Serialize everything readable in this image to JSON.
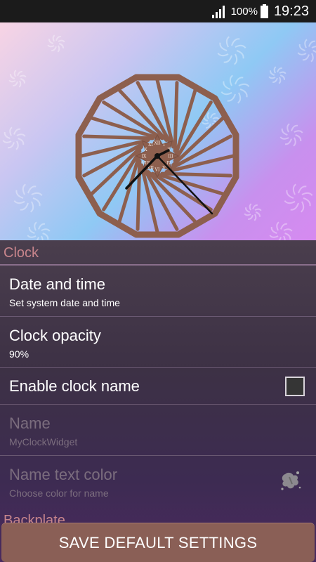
{
  "status_bar": {
    "battery_percent": "100%",
    "time": "19:23",
    "icons": [
      "signal-icon",
      "battery-icon"
    ]
  },
  "preview": {
    "widget": "clock-widget",
    "dial_numerals": [
      "I",
      "II",
      "III",
      "IV",
      "V",
      "VI",
      "VII",
      "VIII",
      "IX",
      "X",
      "XI",
      "XII"
    ]
  },
  "settings": {
    "category": "Clock",
    "items": [
      {
        "title": "Date and time",
        "summary": "Set system date and time"
      },
      {
        "title": "Clock opacity",
        "summary": "90%"
      },
      {
        "title": "Enable clock name",
        "checked": false
      },
      {
        "title": "Name",
        "summary": "MyClockWidget",
        "enabled": false
      },
      {
        "title": "Name text color",
        "summary": "Choose color for name",
        "enabled": false
      }
    ],
    "next_category": "Backplate"
  },
  "save_button": {
    "label": "SAVE DEFAULT SETTINGS"
  },
  "colors": {
    "accent": "#c7858c",
    "button": "#8a5f56",
    "status_bar": "#1b1b1b",
    "frame": "#8d5f4e"
  }
}
